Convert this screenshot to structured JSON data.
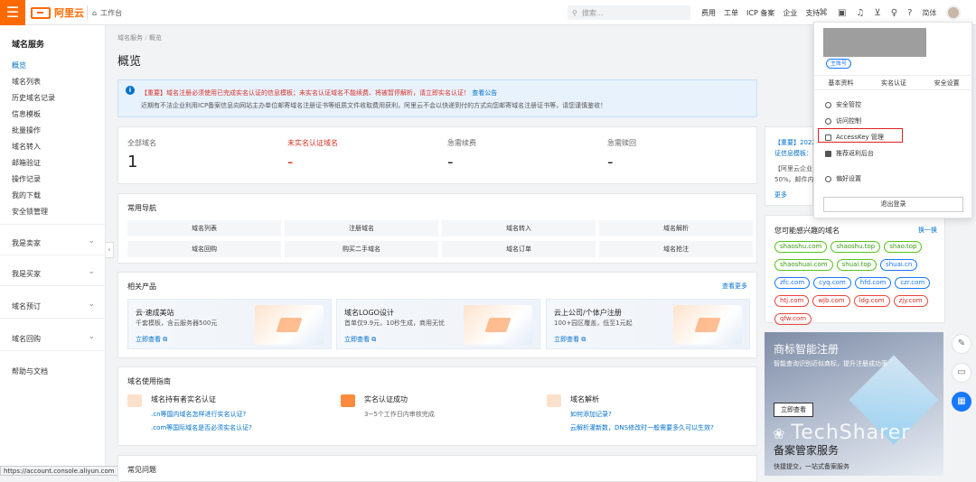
{
  "topbar": {
    "brand": "阿里云",
    "workbench": "工作台",
    "search_placeholder": "搜索...",
    "nav": [
      "费用",
      "工单",
      "ICP 备案",
      "企业",
      "支持"
    ],
    "lang": "简体"
  },
  "sidebar": {
    "title": "域名服务",
    "items": [
      "概览",
      "域名列表",
      "历史域名记录",
      "信息模板",
      "批量操作",
      "域名转入",
      "邮箱验证",
      "操作记录",
      "我的下载",
      "安全锁管理"
    ],
    "groups": [
      "我是卖家",
      "我是买家",
      "域名预订",
      "域名回购",
      "帮助与文档"
    ]
  },
  "status_url": "https://account.console.aliyun.com",
  "breadcrumb": [
    "域名服务",
    "概览"
  ],
  "page_title": "概览",
  "notice": {
    "line1_prefix": "【重要】域名注册必须使用已完成实名认证的信息模板；未实名认证域名不能续费、将被暂停解析，请立即实名认证！",
    "line1_link": "查看公告",
    "line2": "近期有不法企业利用ICP备案信息向网站主办单位邮寄域名注册证书等纸质文件收取费用获利，阿里云不会以快递到付的方式向您邮寄域名注册证书等，请您谨慎鉴收！"
  },
  "stats": [
    {
      "label": "全部域名",
      "value": "1"
    },
    {
      "label": "未实名认证域名",
      "value": "-"
    },
    {
      "label": "急需续费",
      "value": "-"
    },
    {
      "label": "急需赎回",
      "value": "-"
    }
  ],
  "common_nav": {
    "title": "常用导航",
    "items": [
      "域名列表",
      "注册域名",
      "域名转入",
      "域名解析",
      "域名回购",
      "购买二手域名",
      "域名订单",
      "域名抢注"
    ]
  },
  "products": {
    "title": "相关产品",
    "more": "查看更多",
    "items": [
      {
        "title": "云·速成美站",
        "desc": "千套模板，含云服务器500元",
        "link": "立即查看"
      },
      {
        "title": "域名LOGO设计",
        "desc": "首单仅9.9元，10秒生成，商用无忧",
        "link": "立即查看"
      },
      {
        "title": "云上公司/个体户注册",
        "desc": "100+园区覆盖，低至1元起",
        "link": "立即查看"
      }
    ]
  },
  "guide": {
    "title": "域名使用指南",
    "cols": [
      {
        "title": "域名持有者实名认证",
        "lines": [
          ".cn等国内域名怎样进行实名认证?",
          ".com等国际域名是否必须实名认证?"
        ]
      },
      {
        "title": "实名认证成功",
        "lines": [
          "3~5个工作日内审核完成"
        ]
      },
      {
        "title": "域名解析",
        "lines": [
          "如何添加记录?",
          "云解析灌新数，DNS修改时一般需要多久可以生效?"
        ]
      }
    ]
  },
  "faq_title": "常见问题",
  "right_notice": {
    "l1": "【重要】2022",
    "l2": "证信息模板：",
    "l3": "【阿里云企业",
    "l4": "50%。邮件内",
    "more": "更多"
  },
  "interest": {
    "title": "您可能感兴趣的域名",
    "refresh": "换一换",
    "tags": [
      {
        "t": "shaoshu.com",
        "c": "g"
      },
      {
        "t": "shaoshu.top",
        "c": "g"
      },
      {
        "t": "shao.top",
        "c": "g"
      },
      {
        "t": "shaoshuai.com",
        "c": "g"
      },
      {
        "t": "shuai.top",
        "c": "g"
      },
      {
        "t": "shuai.cn",
        "c": "b"
      },
      {
        "t": "zfc.com",
        "c": "b"
      },
      {
        "t": "cyq.com",
        "c": "b"
      },
      {
        "t": "hfd.com",
        "c": "b"
      },
      {
        "t": "czr.com",
        "c": "b"
      },
      {
        "t": "htj.com",
        "c": "r"
      },
      {
        "t": "wjb.com",
        "c": "r"
      },
      {
        "t": "ldg.com",
        "c": "r"
      },
      {
        "t": "zjy.com",
        "c": "r"
      },
      {
        "t": "qfw.com",
        "c": "r"
      }
    ]
  },
  "banner": {
    "title": "商标智能注册",
    "sub": "智能查询识别近似商标，提升注册成功率",
    "btn": "立即查看",
    "title2": "备案管家服务",
    "sub2": "快捷提交，一站式备案服务",
    "watermark": "TechSharer"
  },
  "popover": {
    "badge": "主账号",
    "tabs": [
      "基本资料",
      "实名认证",
      "安全设置"
    ],
    "menu": [
      "安全管控",
      "访问控制",
      "AccessKey 管理",
      "推荐返利后台",
      "偏好设置"
    ],
    "logout": "退出登录"
  }
}
